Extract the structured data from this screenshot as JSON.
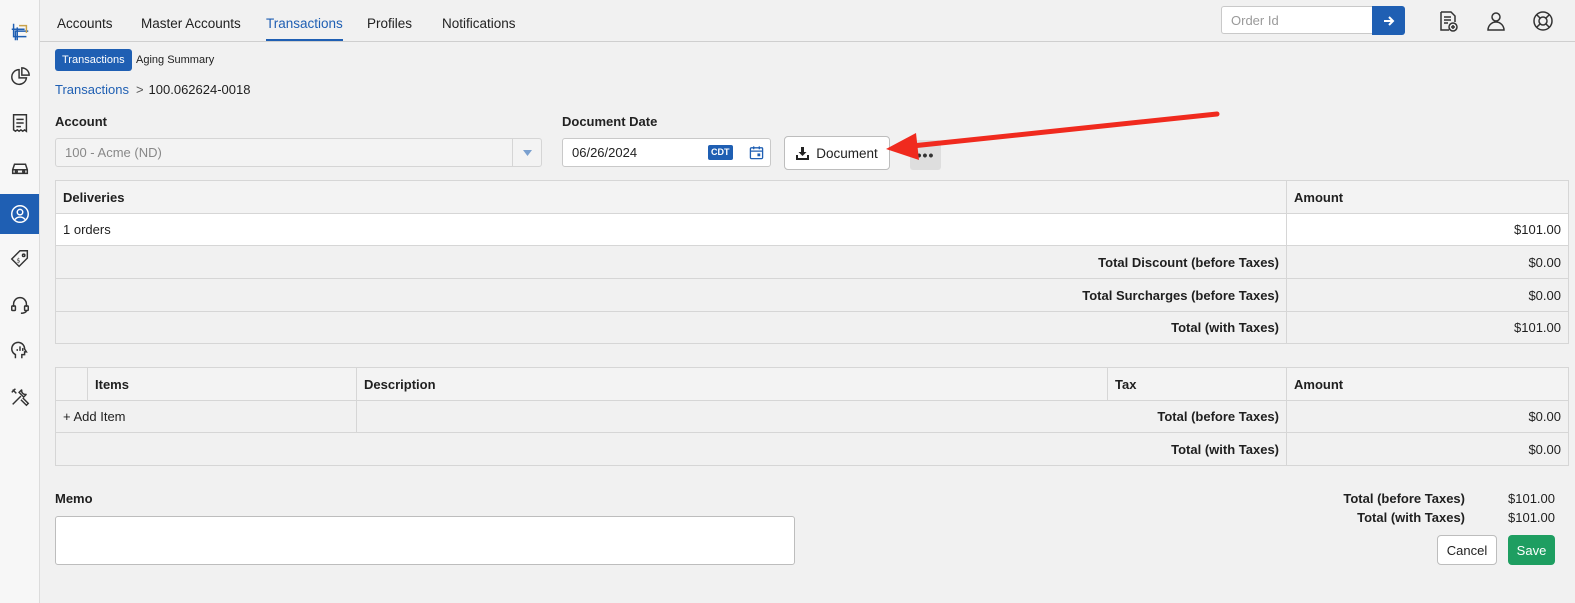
{
  "nav": {
    "tabs": [
      {
        "label": "Accounts"
      },
      {
        "label": "Master Accounts"
      },
      {
        "label": "Transactions"
      },
      {
        "label": "Profiles"
      },
      {
        "label": "Notifications"
      }
    ],
    "order_placeholder": "Order Id"
  },
  "subtabs": {
    "active": "Transactions",
    "other": "Aging Summary"
  },
  "breadcrumb": {
    "parent": "Transactions",
    "separator": ">",
    "current": "100.062624-0018"
  },
  "form": {
    "account_label": "Account",
    "account_value": "100 - Acme (ND)",
    "date_label": "Document Date",
    "date_value": "06/26/2024",
    "timezone": "CDT",
    "document_button": "Document",
    "more_button": "•••"
  },
  "deliveries": {
    "header": {
      "name": "Deliveries",
      "amount": "Amount"
    },
    "row": {
      "name": "1 orders",
      "amount": "$101.00"
    },
    "totals": [
      {
        "label": "Total Discount (before Taxes)",
        "amount": "$0.00"
      },
      {
        "label": "Total Surcharges (before Taxes)",
        "amount": "$0.00"
      },
      {
        "label": "Total (with Taxes)",
        "amount": "$101.00"
      }
    ]
  },
  "items": {
    "header": {
      "items": "Items",
      "description": "Description",
      "tax": "Tax",
      "amount": "Amount"
    },
    "add_item": "+ Add Item",
    "totals": [
      {
        "label": "Total (before Taxes)",
        "amount": "$0.00"
      },
      {
        "label": "Total (with Taxes)",
        "amount": "$0.00"
      }
    ]
  },
  "memo": {
    "label": "Memo"
  },
  "summary": [
    {
      "label": "Total (before Taxes)",
      "amount": "$101.00"
    },
    {
      "label": "Total (with Taxes)",
      "amount": "$101.00"
    }
  ],
  "actions": {
    "cancel": "Cancel",
    "save": "Save"
  },
  "colors": {
    "accent": "#1f5fb3",
    "save": "#1e9e61",
    "annotation_arrow": "#f02a1e",
    "top_strip": "#e63950"
  }
}
